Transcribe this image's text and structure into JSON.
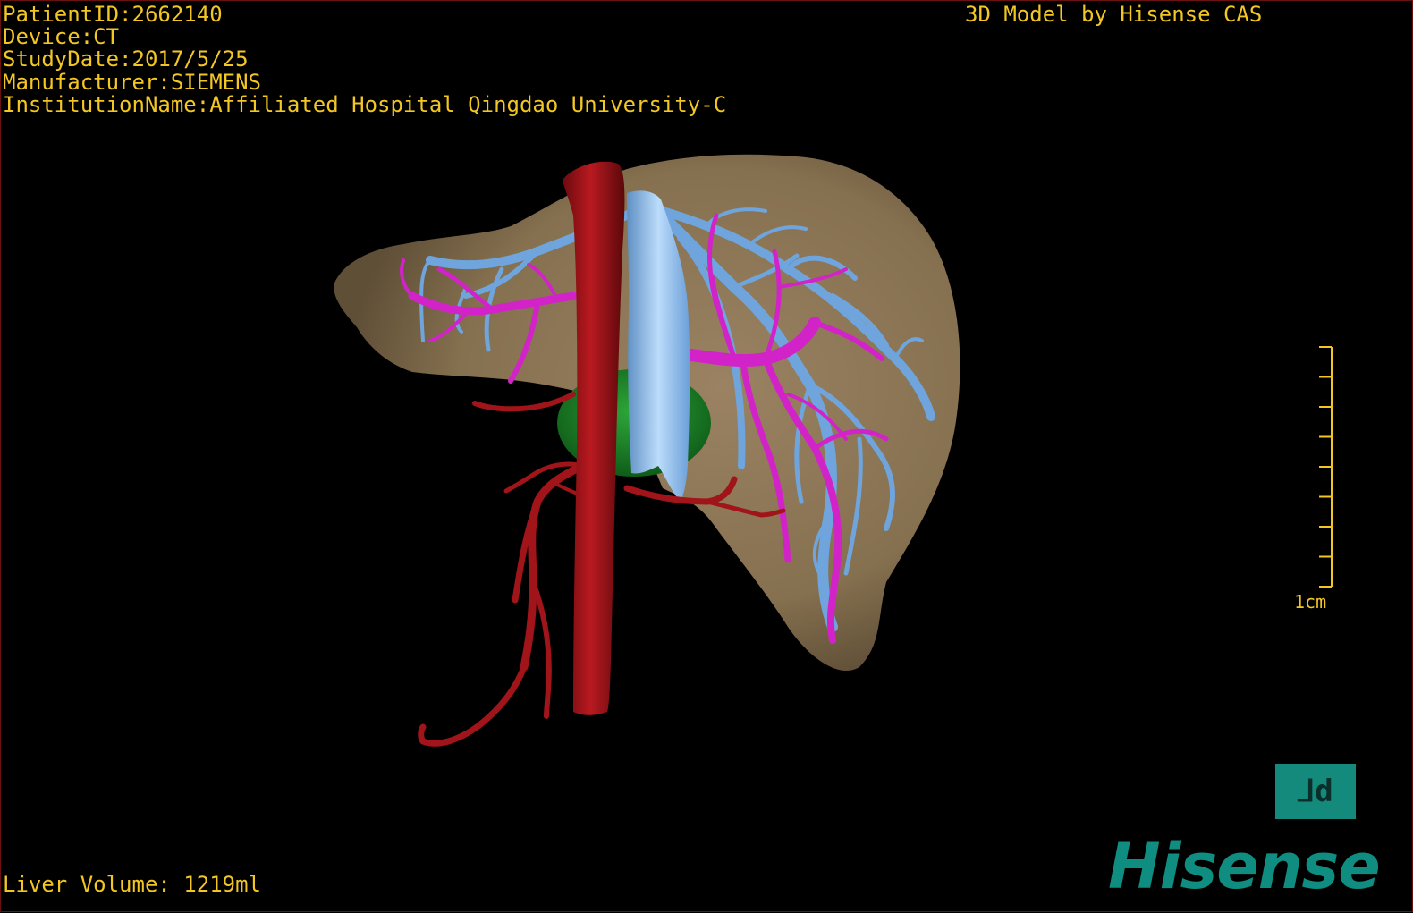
{
  "overlay": {
    "patient_id": "PatientID:2662140",
    "device": "Device:CT",
    "study_date": "StudyDate:2017/5/25",
    "manufacturer": "Manufacturer:SIEMENS",
    "institution": "InstitutionName:Affiliated Hospital Qingdao University-C",
    "credit": "3D Model by Hisense CAS",
    "liver_volume": "Liver Volume: 1219ml"
  },
  "scale_bar": {
    "label": "1cm",
    "ticks": 9
  },
  "logo": {
    "glyph": "⅃d",
    "brand": "Hisense"
  },
  "colors": {
    "text": "#f2c623",
    "liver": "#8d7656",
    "aorta": "#a0141a",
    "portal_vein": "#d223c9",
    "hepatic_vein": "#6fa5dc",
    "ivc": "#8ec2ee",
    "gallbladder": "#1e8a28",
    "brand": "#0f8d80"
  }
}
